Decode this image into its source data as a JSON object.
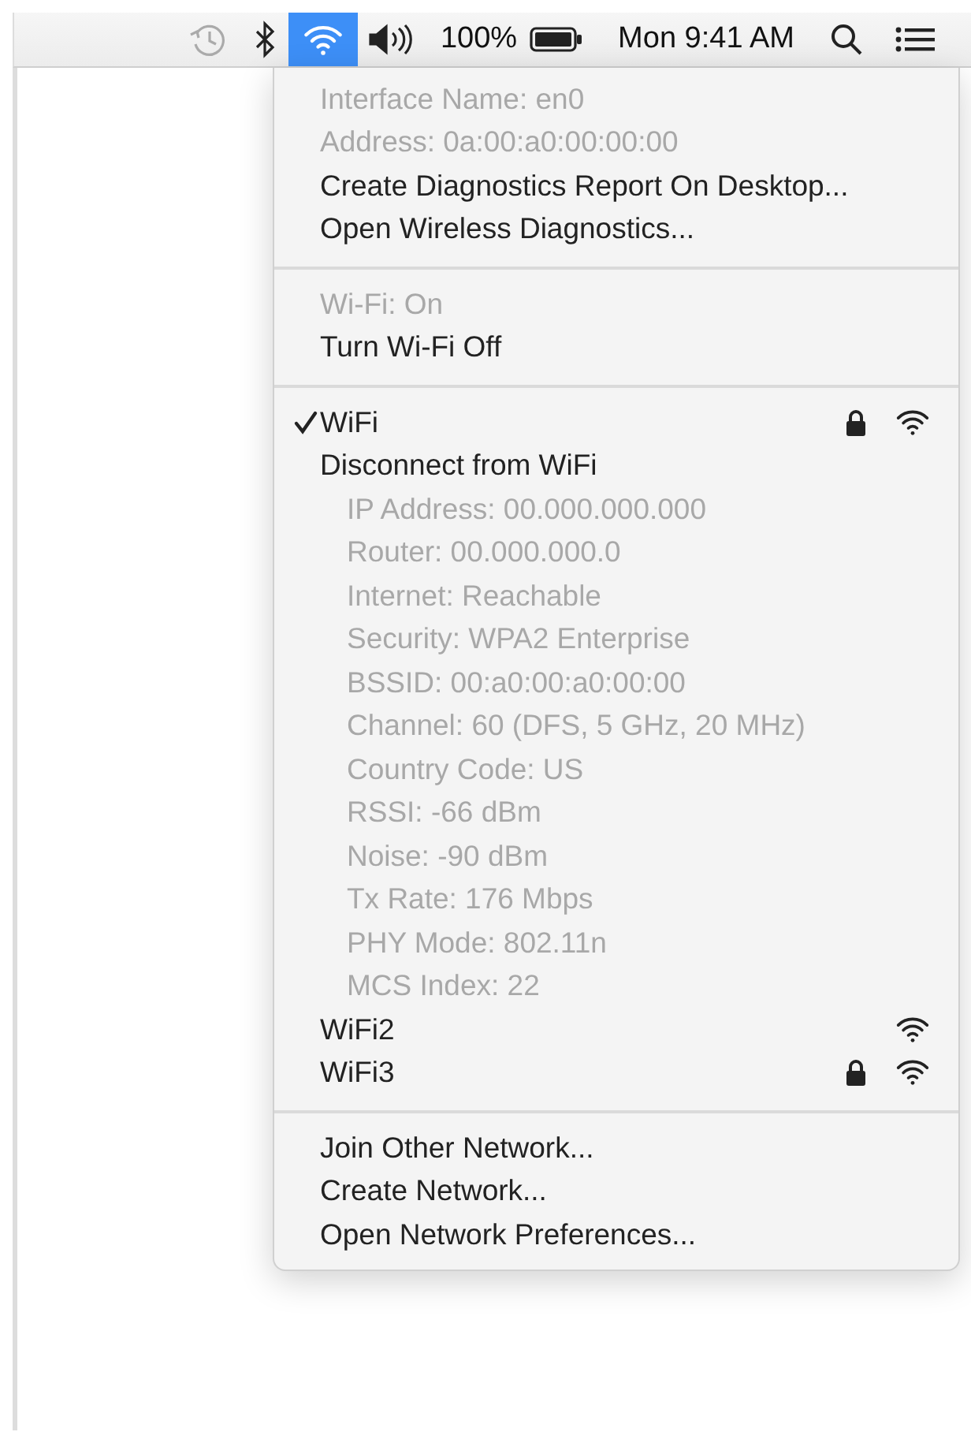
{
  "menu_bar": {
    "items": [
      {
        "kind": "time-machine",
        "selected": false,
        "disabled": true
      },
      {
        "kind": "bluetooth",
        "selected": false,
        "disabled": false
      },
      {
        "kind": "wifi",
        "selected": true,
        "disabled": false
      },
      {
        "kind": "volume",
        "selected": false,
        "disabled": false
      },
      {
        "kind": "battery",
        "label": "100%",
        "selected": false,
        "disabled": false
      },
      {
        "kind": "clock",
        "label": "Mon 9:41 AM",
        "selected": false,
        "disabled": false
      },
      {
        "kind": "search",
        "selected": false,
        "disabled": false
      },
      {
        "kind": "list",
        "selected": false,
        "disabled": false
      }
    ]
  },
  "wifi_menu": {
    "sections": [
      {
        "items": [
          {
            "kind": "text",
            "label": "Interface Name: en0",
            "disabled": true
          },
          {
            "kind": "text",
            "label": "Address: 0a:00:a0:00:00:00",
            "disabled": true
          },
          {
            "kind": "text",
            "label": "Create Diagnostics Report On Desktop...",
            "disabled": false
          },
          {
            "kind": "text",
            "label": "Open Wireless Diagnostics...",
            "disabled": false
          }
        ]
      },
      {
        "items": [
          {
            "kind": "text",
            "label": "Wi-Fi: On",
            "disabled": true
          },
          {
            "kind": "text",
            "label": "Turn Wi-Fi Off",
            "disabled": false
          }
        ]
      },
      {
        "items": [
          {
            "kind": "network",
            "label": "WiFi",
            "selected": true,
            "locked": true
          },
          {
            "kind": "text",
            "label": "Disconnect from WiFi",
            "disabled": false,
            "children": [
              {
                "label": "IP Address: 00.000.000.000",
                "disabled": true
              },
              {
                "label": "Router: 00.000.000.0",
                "disabled": true
              },
              {
                "label": "Internet: Reachable",
                "disabled": true
              },
              {
                "label": "Security: WPA2 Enterprise",
                "disabled": true
              },
              {
                "label": "BSSID: 00:a0:00:a0:00:00",
                "disabled": true
              },
              {
                "label": "Channel: 60 (DFS, 5 GHz, 20 MHz)",
                "disabled": true
              },
              {
                "label": "Country Code: US",
                "disabled": true
              },
              {
                "label": "RSSI: -66 dBm",
                "disabled": true
              },
              {
                "label": "Noise: -90 dBm",
                "disabled": true
              },
              {
                "label": "Tx Rate: 176 Mbps",
                "disabled": true
              },
              {
                "label": "PHY Mode: 802.11n",
                "disabled": true
              },
              {
                "label": "MCS Index: 22",
                "disabled": true
              }
            ]
          },
          {
            "kind": "network",
            "label": "WiFi2",
            "selected": false,
            "locked": false
          },
          {
            "kind": "network",
            "label": "WiFi3",
            "selected": false,
            "locked": true
          }
        ]
      },
      {
        "items": [
          {
            "kind": "text",
            "label": "Join Other Network...",
            "disabled": false
          },
          {
            "kind": "text",
            "label": "Create Network...",
            "disabled": false
          },
          {
            "kind": "text",
            "label": "Open Network Preferences...",
            "disabled": false
          }
        ]
      }
    ]
  }
}
